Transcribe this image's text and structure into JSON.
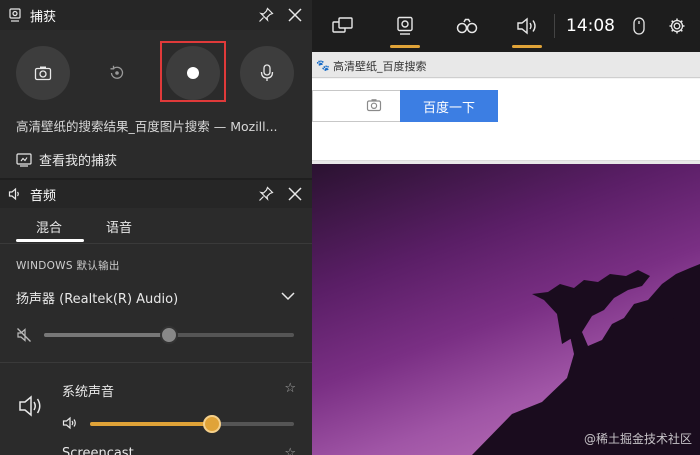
{
  "capture": {
    "title": "捕获",
    "window_info": "高清壁纸的搜索结果_百度图片搜索 — Mozill...",
    "show_captures": "查看我的捕获"
  },
  "audio": {
    "title": "音频",
    "tabs": [
      "混合",
      "语音"
    ],
    "section_label": "WINDOWS 默认输出",
    "device": "扬声器 (Realtek(R) Audio)",
    "master_volume": 0.5,
    "master_muted": true,
    "app_name": "系统声音",
    "app_volume": 0.6,
    "next_app_name": "Screencast"
  },
  "gamebar": {
    "time": "14:08"
  },
  "browser": {
    "tab_title": "高清壁纸_百度搜索",
    "search_button": "百度一下",
    "watermark": "@稀土掘金技术社区"
  },
  "colors": {
    "accent": "#e0a338",
    "highlight": "#e03a3a",
    "search_blue": "#3c7ee3"
  }
}
